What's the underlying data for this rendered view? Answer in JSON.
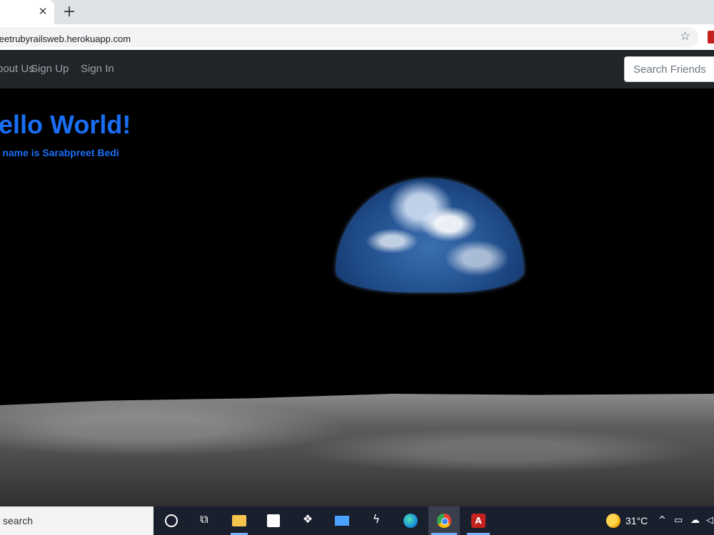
{
  "browser": {
    "tab_close": "✕",
    "new_tab": "+",
    "url": "bpreetrubyrailsweb.herokuapp.com",
    "star": "☆"
  },
  "navbar": {
    "links": [
      "About Us",
      "Sign Up",
      "Sign In"
    ],
    "search_placeholder": "Search Friends"
  },
  "hero": {
    "title": "Hello World!",
    "subtitle": "My name is Sarabpreet Bedi"
  },
  "taskbar": {
    "search_text": "search",
    "temperature": "31°C",
    "icons": [
      "cortana-icon",
      "task-view-icon",
      "file-explorer-icon",
      "store-icon",
      "dropbox-icon",
      "mail-icon",
      "bolt-icon",
      "edge-icon",
      "chrome-icon",
      "acrobat-icon"
    ],
    "taskview_glyph": "⧉",
    "dropbox_glyph": "❖",
    "bolt_glyph": "ϟ",
    "pdf_glyph": "A",
    "tray_up": "^",
    "tray_battery": "▭",
    "tray_cloud": "☁",
    "tray_volume": "◁"
  }
}
